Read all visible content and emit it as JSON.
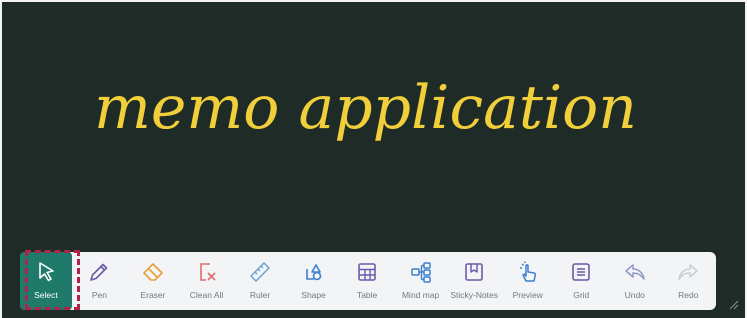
{
  "canvas": {
    "handwritten_text": "memo application",
    "background_color": "#1f2b26",
    "ink_color": "#f0cf3a"
  },
  "toolbar": {
    "active_color": "#1f7a69",
    "tools": [
      {
        "label": "Select",
        "icon": "cursor-arrow-icon",
        "active": true
      },
      {
        "label": "Pen",
        "icon": "pen-icon"
      },
      {
        "label": "Eraser",
        "icon": "eraser-icon"
      },
      {
        "label": "Clean All",
        "icon": "clean-all-icon"
      },
      {
        "label": "Ruler",
        "icon": "ruler-icon"
      },
      {
        "label": "Shape",
        "icon": "shape-icon"
      },
      {
        "label": "Table",
        "icon": "table-icon"
      },
      {
        "label": "Mind map",
        "icon": "mind-map-icon"
      },
      {
        "label": "Sticky-Notes",
        "icon": "sticky-notes-icon"
      },
      {
        "label": "Preview",
        "icon": "pointer-hand-icon"
      },
      {
        "label": "Grid",
        "icon": "grid-icon"
      },
      {
        "label": "Undo",
        "icon": "undo-icon"
      },
      {
        "label": "Redo",
        "icon": "redo-icon"
      }
    ]
  }
}
